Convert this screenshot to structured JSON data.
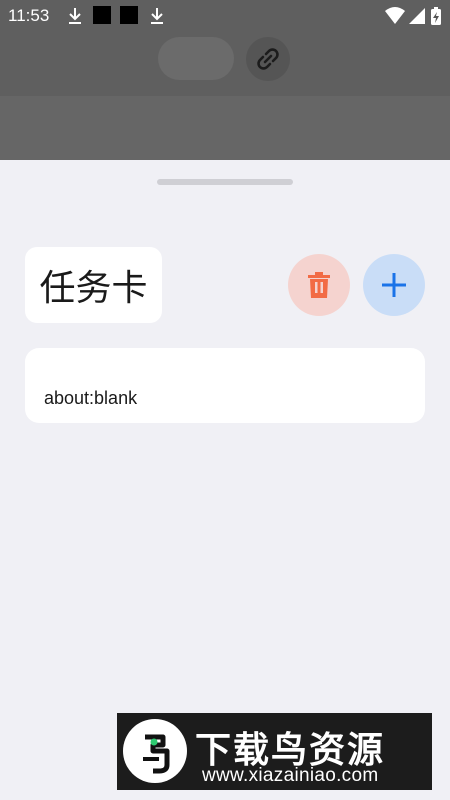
{
  "status_bar": {
    "time": "11:53",
    "left_icons": [
      "download-icon",
      "notification-square",
      "notification-square",
      "download-icon"
    ],
    "right_icons": [
      "wifi-icon",
      "signal-icon",
      "battery-charging-icon"
    ]
  },
  "background_toolbar": {
    "icons": [
      "link-icon"
    ]
  },
  "sheet": {
    "title": "任务卡",
    "delete_icon": "trash-icon",
    "add_icon": "plus-icon",
    "cards": [
      {
        "url": "about:blank"
      }
    ]
  },
  "watermark": {
    "title": "下载鸟资源",
    "url": "www.xiazainiao.com"
  },
  "colors": {
    "delete_bg": "#f5d3cf",
    "delete_icon": "#f26b45",
    "add_bg": "#c9ddf7",
    "add_icon": "#1a73e8",
    "sheet_bg": "#f0f0f5"
  }
}
